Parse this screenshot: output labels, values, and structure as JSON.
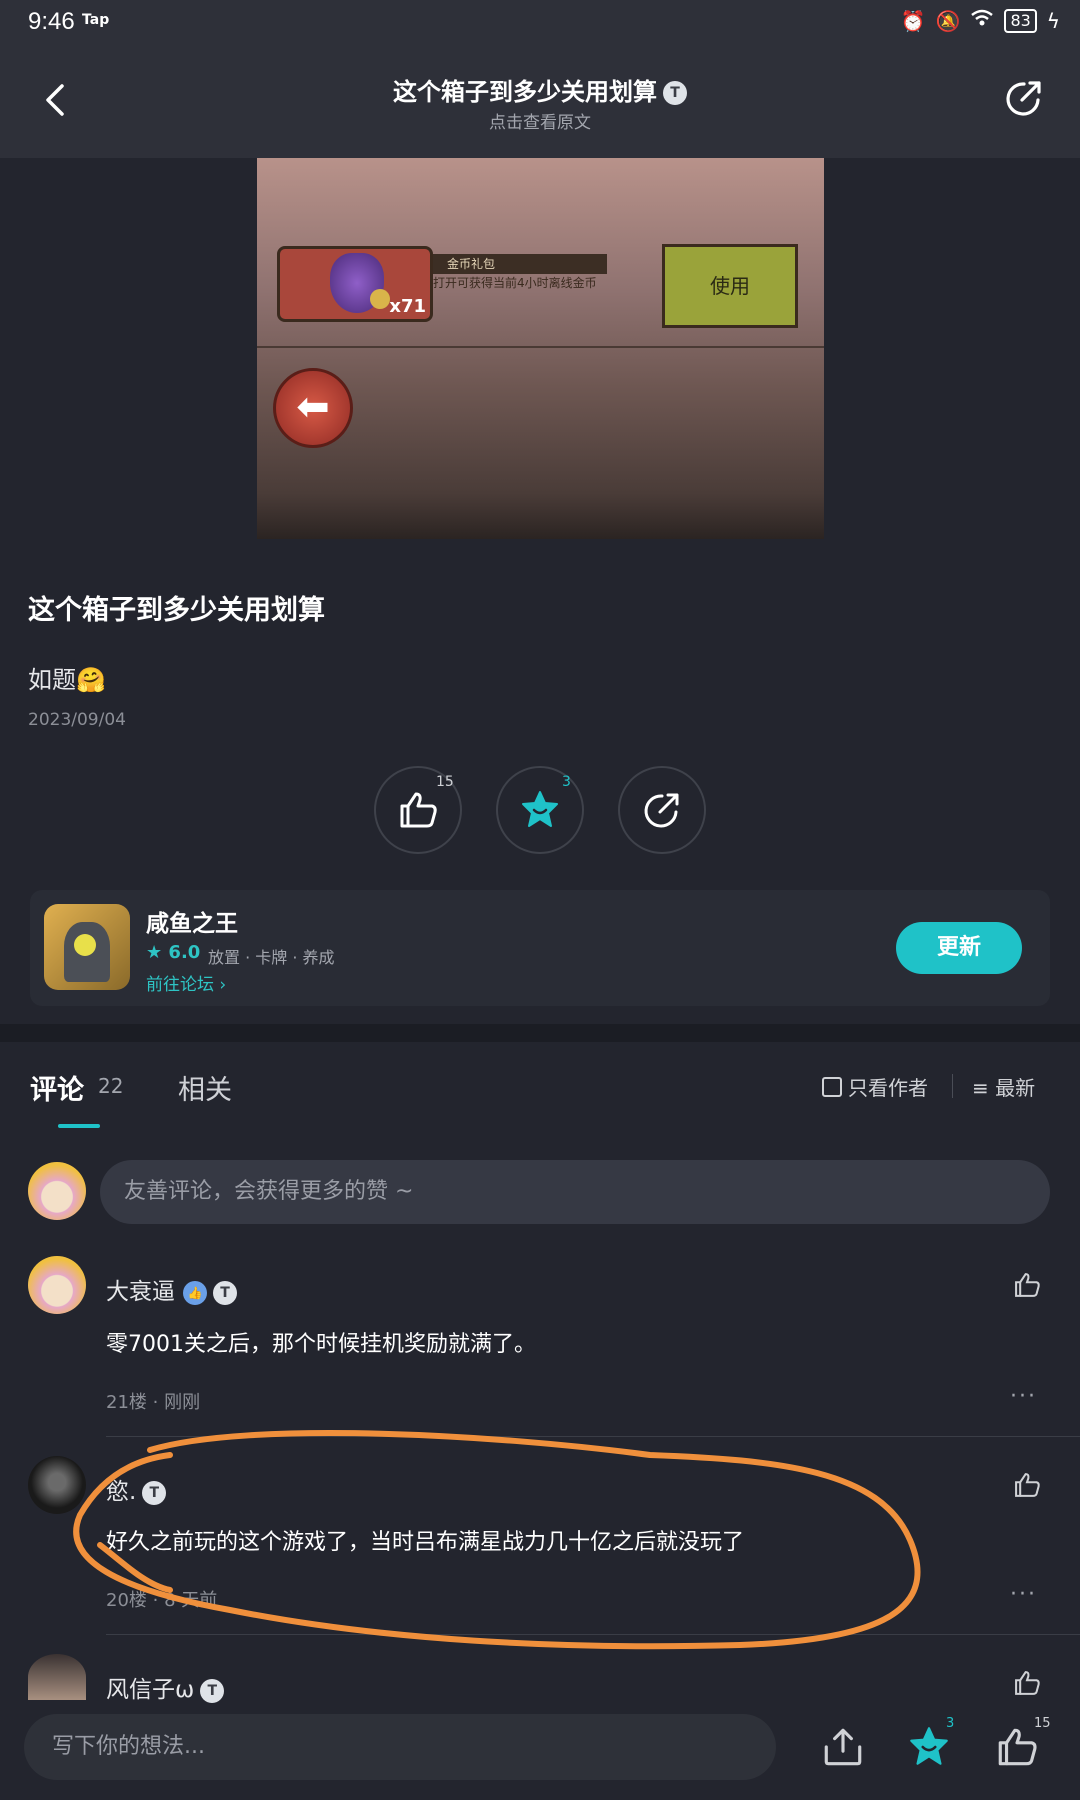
{
  "status_bar": {
    "time": "9:46",
    "tap_label": "Tap",
    "battery": "83"
  },
  "header": {
    "title": "这个箱子到多少关用划算",
    "badge": "T",
    "subtitle": "点击查看原文"
  },
  "post_image": {
    "item_tag": "金币礼包",
    "item_desc": "打开可获得当前4小时离线金币",
    "item_count": "x71",
    "use_label": "使用"
  },
  "post": {
    "title": "这个箱子到多少关用划算",
    "body": "如题",
    "emoji": "🤗",
    "date": "2023/09/04"
  },
  "actions": {
    "like_count": "15",
    "favorite_count": "3"
  },
  "app_card": {
    "name": "咸鱼之王",
    "rating": "6.0",
    "tags": "放置 · 卡牌 · 养成",
    "forum_link": "前往论坛 ›",
    "update_label": "更新"
  },
  "comments_header": {
    "tab_comments": "评论",
    "comment_count": "22",
    "tab_related": "相关",
    "only_author": "只看作者",
    "sort": "最新"
  },
  "comment_input": {
    "placeholder": "友善评论，会获得更多的赞 ~"
  },
  "comments": [
    {
      "name": "大衰逼",
      "text": "零7001关之后，那个时候挂机奖励就满了。",
      "floor": "21楼",
      "time": "刚刚"
    },
    {
      "name": "慾.",
      "text": "好久之前玩的这个游戏了，当时吕布满星战力几十亿之后就没玩了",
      "floor": "20楼",
      "time": "8 天前"
    },
    {
      "name": "风信子ω",
      "text": "",
      "floor": "",
      "time": ""
    }
  ],
  "bottom_bar": {
    "placeholder": "写下你的想法...",
    "favorite_count": "3",
    "like_count": "15"
  },
  "colors": {
    "background": "#23252e",
    "header": "#2e3039",
    "accent": "#1fc2c8",
    "annotation": "#f0903c"
  },
  "icons": [
    "back-arrow-icon",
    "share-icon",
    "thumb-up-icon",
    "star-face-icon",
    "upload-icon",
    "more-icon",
    "sort-icon",
    "checkbox-icon"
  ]
}
